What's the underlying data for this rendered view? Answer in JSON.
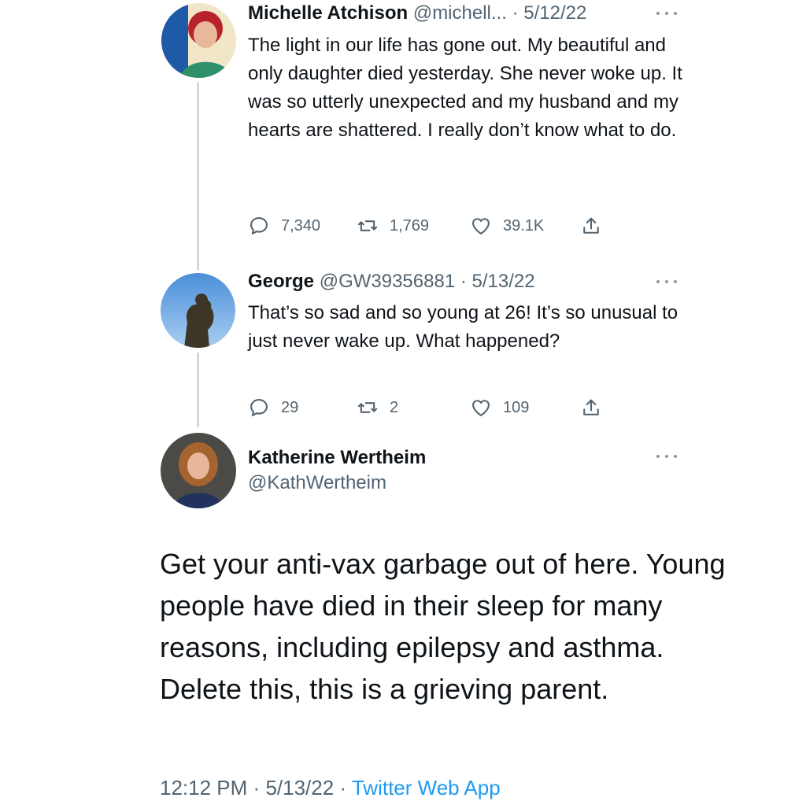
{
  "tweets": [
    {
      "name": "Michelle Atchison",
      "handle": "@michell...",
      "separator": "·",
      "date": "5/12/22",
      "text": "The light in our life has gone out. My beautiful and only daughter died yesterday. She never woke up. It was so utterly unexpected and my husband and my hearts are shattered. I really don’t know what to do.",
      "replies": "7,340",
      "retweets": "1,769",
      "likes": "39.1K"
    },
    {
      "name": "George",
      "handle": "@GW39356881",
      "separator": "·",
      "date": "5/13/22",
      "text": "That’s so sad and so young at 26! It’s so unusual to just never wake up. What happened?",
      "replies": "29",
      "retweets": "2",
      "likes": "109"
    }
  ],
  "main_tweet": {
    "name": "Katherine Wertheim",
    "handle": "@KathWertheim",
    "text": "Get your anti-vax garbage out of here. Young people have died in their sleep for many reasons, including epilepsy and asthma. Delete this, this is a grieving parent.",
    "time": "12:12 PM",
    "separator": "·",
    "date": "5/13/22",
    "source": "Twitter Web App"
  },
  "colors": {
    "text": "#0f1419",
    "secondary": "#536471",
    "link": "#1d9bf0",
    "thread_line": "#cfd9de"
  },
  "icons": [
    "reply-icon",
    "retweet-icon",
    "like-icon",
    "share-icon",
    "more-icon"
  ]
}
